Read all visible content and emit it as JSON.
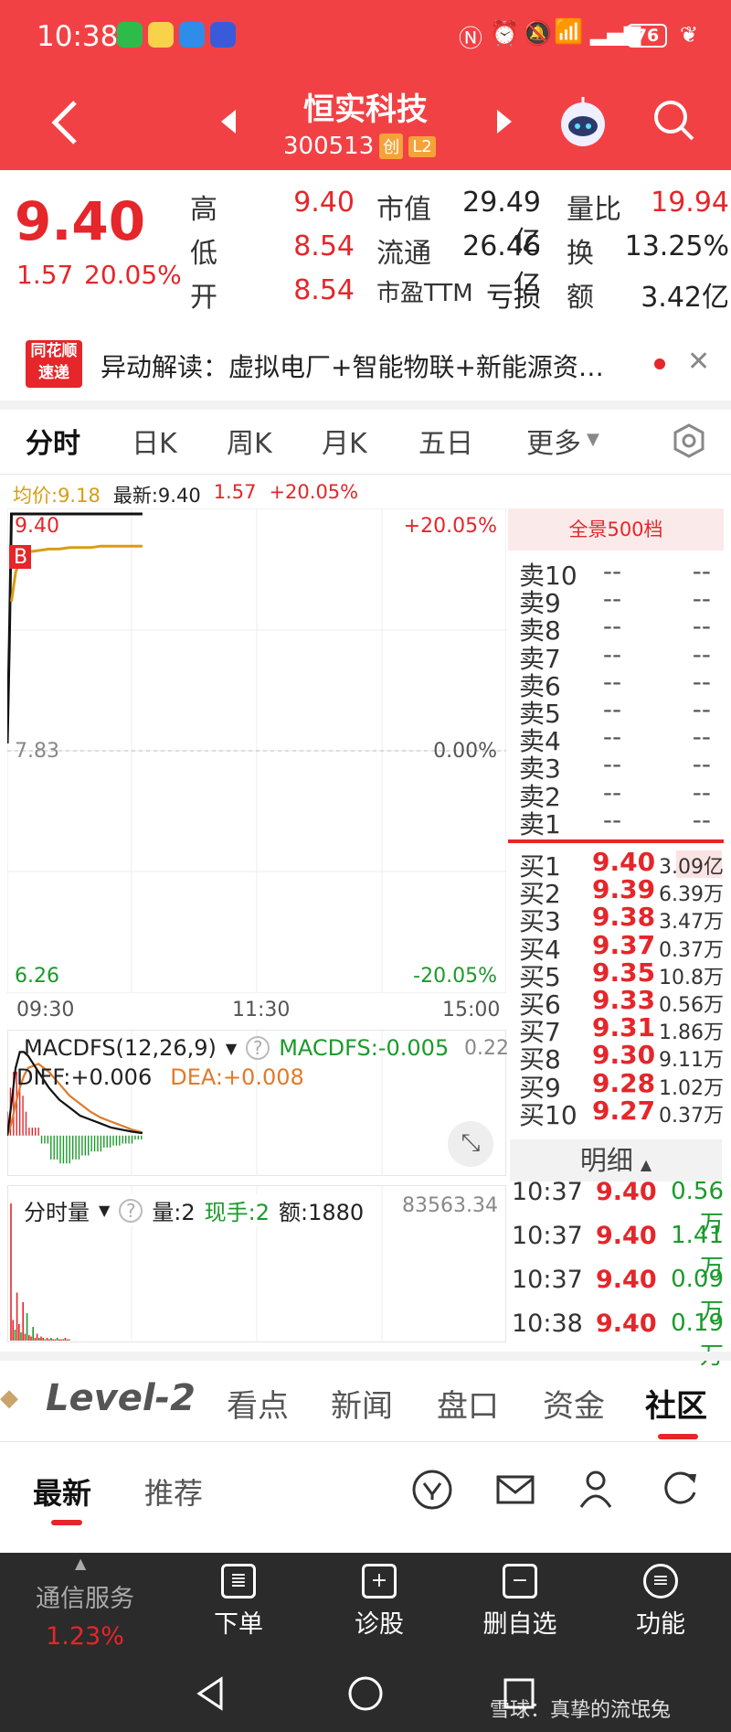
{
  "status_bar": {
    "time": "10:38",
    "battery": "76"
  },
  "header": {
    "title": "恒实科技",
    "code": "300513",
    "badge_chuang": "创",
    "badge_l2": "L2"
  },
  "quote": {
    "price": "9.40",
    "change": "1.57",
    "change_pct": "20.05%",
    "rows": [
      {
        "l1": "高",
        "v1": "9.40",
        "l2": "市值",
        "v2": "29.49亿",
        "l3": "量比",
        "v3": "19.94"
      },
      {
        "l1": "低",
        "v1": "8.54",
        "l2": "流通",
        "v2": "26.46亿",
        "l3": "换",
        "v3": "13.25%"
      },
      {
        "l1": "开",
        "v1": "8.54",
        "l2": "市盈TTM",
        "v2": "亏损",
        "l3": "额",
        "v3": "3.42亿"
      }
    ]
  },
  "news": {
    "logo_line1": "同花顺",
    "logo_line2": "速递",
    "text": "异动解读：虚拟电厂+智能物联+新能源资…"
  },
  "tabs": [
    "分时",
    "日K",
    "周K",
    "月K",
    "五日",
    "更多"
  ],
  "chart_header": {
    "avg": "均价:9.18",
    "latest": "最新:9.40",
    "chg": "1.57",
    "pct": "+20.05%"
  },
  "chart_data": {
    "type": "line",
    "title": "",
    "ylim": [
      6.26,
      9.4
    ],
    "y_top_label": "9.40",
    "y_mid_label": "7.83",
    "y_bottom_label": "6.26",
    "pct_top": "+20.05%",
    "pct_mid": "0.00%",
    "pct_bottom": "-20.05%",
    "x_labels": [
      "09:30",
      "11:30",
      "15:00"
    ],
    "series": [
      {
        "color": "#111111",
        "x": [
          0,
          1,
          2,
          3,
          4,
          5,
          6,
          7,
          8,
          10,
          15,
          20,
          25,
          30,
          35,
          40,
          45,
          50,
          55,
          60,
          65
        ],
        "values": [
          7.83,
          8.54,
          9.4,
          9.4,
          9.4,
          9.4,
          9.4,
          9.4,
          9.4,
          9.4,
          9.4,
          9.4,
          9.4,
          9.4,
          9.4,
          9.4,
          9.4,
          9.4,
          9.4,
          9.4,
          9.4
        ]
      },
      {
        "color": "#d79d12",
        "x": [
          2,
          4,
          6,
          8,
          10,
          15,
          20,
          25,
          30,
          35,
          40,
          45,
          50,
          55,
          60,
          65
        ],
        "values": [
          8.8,
          9.0,
          9.08,
          9.12,
          9.14,
          9.15,
          9.16,
          9.16,
          9.17,
          9.17,
          9.17,
          9.18,
          9.18,
          9.18,
          9.18,
          9.18
        ]
      }
    ],
    "total_minutes": 240,
    "b_marker": "B"
  },
  "macd": {
    "name": "MACDFS(12,26,9)",
    "macdfs": "MACDFS:-0.005",
    "diff": "DIFF:+0.006",
    "dea": "DEA:+0.008",
    "right_val": "0.22",
    "x": [
      0,
      2,
      4,
      6,
      8,
      10,
      15,
      20,
      25,
      30,
      35,
      40,
      45,
      50,
      55,
      60,
      65
    ],
    "diff_vals": [
      0.0,
      0.08,
      0.17,
      0.21,
      0.21,
      0.2,
      0.16,
      0.12,
      0.09,
      0.07,
      0.05,
      0.04,
      0.03,
      0.02,
      0.015,
      0.01,
      0.006
    ],
    "dea_vals": [
      0.0,
      0.03,
      0.08,
      0.12,
      0.15,
      0.17,
      0.18,
      0.16,
      0.13,
      0.1,
      0.08,
      0.06,
      0.045,
      0.035,
      0.025,
      0.015,
      0.008
    ],
    "bars": [
      0.06,
      0.12,
      0.16,
      0.16,
      0.1,
      0.06,
      0.02,
      -0.02,
      -0.06,
      -0.07,
      -0.06,
      -0.05,
      -0.04,
      -0.03,
      -0.025,
      -0.02,
      -0.01
    ],
    "range": [
      -0.09,
      0.22
    ]
  },
  "volume": {
    "name": "分时量",
    "qty": "量:2",
    "hand": "现手:2",
    "amount": "额:1880",
    "right_val": "83563.34",
    "bars": [
      1.0,
      0.15,
      0.08,
      0.35,
      0.12,
      0.06,
      0.28,
      0.05,
      0.2,
      0.04,
      0.03,
      0.1,
      0.02,
      0.05,
      0.02,
      0.03,
      0.02,
      0.01,
      0.02,
      0.01,
      0.02,
      0.01,
      0.01,
      0.02,
      0.01,
      0.01,
      0.01,
      0.02,
      0.01,
      0.01
    ]
  },
  "orderbook": {
    "header": "全景500档",
    "sells": [
      {
        "label": "卖10",
        "p": "--",
        "v": "--"
      },
      {
        "label": "卖9",
        "p": "--",
        "v": "--"
      },
      {
        "label": "卖8",
        "p": "--",
        "v": "--"
      },
      {
        "label": "卖7",
        "p": "--",
        "v": "--"
      },
      {
        "label": "卖6",
        "p": "--",
        "v": "--"
      },
      {
        "label": "卖5",
        "p": "--",
        "v": "--"
      },
      {
        "label": "卖4",
        "p": "--",
        "v": "--"
      },
      {
        "label": "卖3",
        "p": "--",
        "v": "--"
      },
      {
        "label": "卖2",
        "p": "--",
        "v": "--"
      },
      {
        "label": "卖1",
        "p": "--",
        "v": "--"
      }
    ],
    "buys": [
      {
        "label": "买1",
        "p": "9.40",
        "v": "3.09亿"
      },
      {
        "label": "买2",
        "p": "9.39",
        "v": "6.39万"
      },
      {
        "label": "买3",
        "p": "9.38",
        "v": "3.47万"
      },
      {
        "label": "买4",
        "p": "9.37",
        "v": "0.37万"
      },
      {
        "label": "买5",
        "p": "9.35",
        "v": "10.8万"
      },
      {
        "label": "买6",
        "p": "9.33",
        "v": "0.56万"
      },
      {
        "label": "买7",
        "p": "9.31",
        "v": "1.86万"
      },
      {
        "label": "买8",
        "p": "9.30",
        "v": "9.11万"
      },
      {
        "label": "买9",
        "p": "9.28",
        "v": "1.02万"
      },
      {
        "label": "买10",
        "p": "9.27",
        "v": "0.37万"
      }
    ],
    "detail_title": "明细",
    "details": [
      {
        "t": "10:37",
        "p": "9.40",
        "v": "0.56万"
      },
      {
        "t": "10:37",
        "p": "9.40",
        "v": "1.41万"
      },
      {
        "t": "10:37",
        "p": "9.40",
        "v": "0.09万"
      },
      {
        "t": "10:38",
        "p": "9.40",
        "v": "0.19万"
      }
    ]
  },
  "bottom_tabs": [
    "Level-2",
    "看点",
    "新闻",
    "盘口",
    "资金",
    "社区"
  ],
  "sub_tabs": [
    "最新",
    "推荐"
  ],
  "bottom_nav": {
    "sector": "通信服务",
    "sector_pct": "1.23%",
    "items": [
      "下单",
      "诊股",
      "删自选",
      "功能"
    ]
  },
  "watermark": "雪球：真挚的流氓兔",
  "colors": {
    "header_red": "#f24144",
    "up_red": "#e5262a",
    "down_green": "#1b9a2b",
    "avg_gold": "#d79d12",
    "nav_dark": "#2b2b2b"
  }
}
